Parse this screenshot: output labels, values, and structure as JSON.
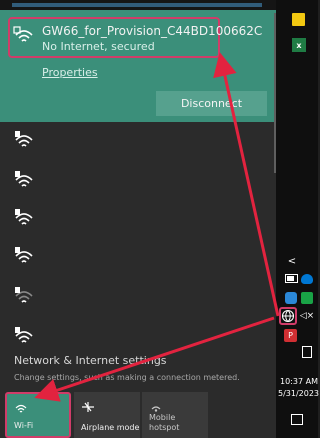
{
  "network": {
    "name": "GW66_for_Provision_C44BD100662C",
    "status": "No Internet, secured",
    "properties_label": "Properties",
    "disconnect_label": "Disconnect"
  },
  "settings": {
    "title": "Network & Internet settings",
    "description": "Change settings, such as making a connection metered."
  },
  "quick_actions": [
    {
      "label": "Wi-Fi",
      "icon": "wifi-icon",
      "active": true
    },
    {
      "label": "Airplane mode",
      "icon": "airplane-icon",
      "active": false
    },
    {
      "label": "Mobile\nhotspot",
      "icon": "hotspot-icon",
      "active": false
    }
  ],
  "taskbar": {
    "time": "10:37 AM",
    "date": "5/31/2023"
  },
  "colors": {
    "accent": "#3b8f7a",
    "highlight": "#d03c69",
    "panel": "#2b2b2b",
    "taskbar": "#0f0f0f"
  }
}
